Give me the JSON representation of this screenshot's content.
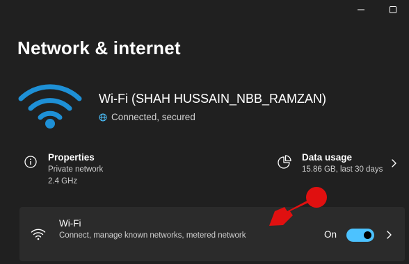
{
  "page": {
    "title": "Network & internet"
  },
  "titlebar": {
    "minimize_icon": "minimize-icon",
    "maximize_icon": "maximize-icon"
  },
  "connection": {
    "icon": "wifi-signal-icon",
    "name": "Wi-Fi (SHAH HUSSAIN_NBB_RAMZAN)",
    "status": "Connected, secured",
    "status_icon": "globe-icon"
  },
  "properties": {
    "icon": "info-icon",
    "title": "Properties",
    "line1": "Private network",
    "line2": "2.4 GHz"
  },
  "data_usage": {
    "icon": "data-usage-icon",
    "title": "Data usage",
    "line1": "15.86 GB, last 30 days"
  },
  "wifi_card": {
    "icon": "wifi-icon",
    "title": "Wi-Fi",
    "description": "Connect, manage known networks, metered network",
    "toggle_label": "On",
    "toggle_on": true
  },
  "colors": {
    "background": "#202020",
    "card": "#2b2b2b",
    "accent": "#4cc2ff",
    "wifi_icon": "#1e90d6",
    "annotation": "#e01010"
  }
}
